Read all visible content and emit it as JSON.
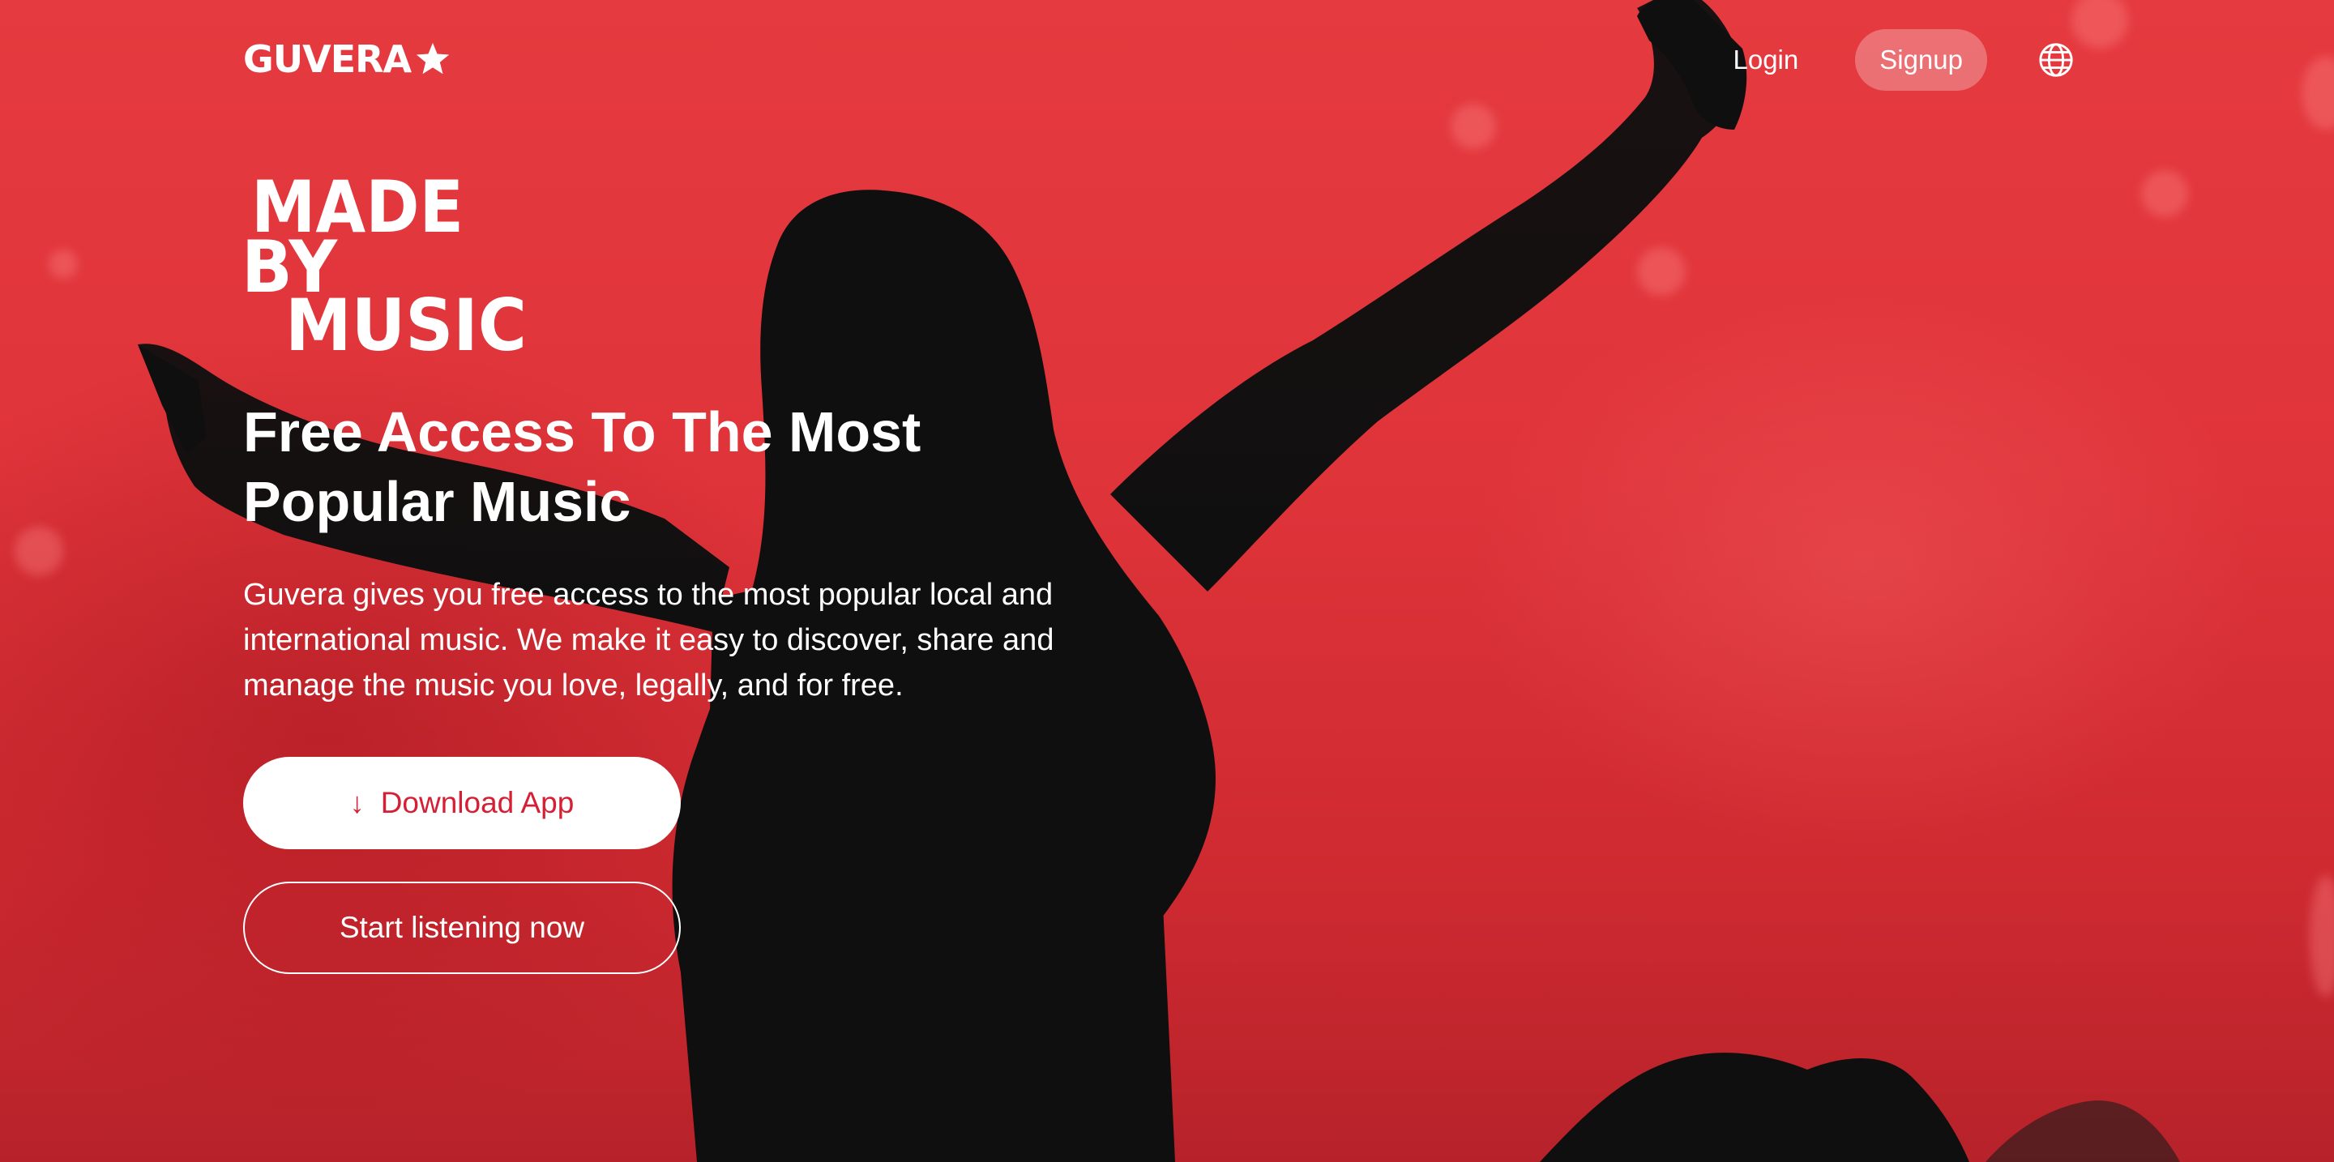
{
  "brand": {
    "logo_text": "GUVERA"
  },
  "nav": {
    "login_label": "Login",
    "signup_label": "Signup",
    "language_icon": "globe-icon"
  },
  "hero": {
    "badge_lines": [
      "MADE",
      "BY",
      "MUSIC"
    ],
    "headline_line1": "Free Access To The Most",
    "headline_line2": "Popular Music",
    "description": "Guvera gives you free access to the most popular local and international music. We make it easy to discover, share and manage the music you love, legally, and for free.",
    "download_label": "Download App",
    "download_icon": "arrow-down-icon",
    "listen_label": "Start listening now"
  },
  "colors": {
    "background_red": "#e53a3f",
    "silhouette": "#0f0f0f",
    "accent_red": "#d51f35",
    "white": "#ffffff"
  }
}
